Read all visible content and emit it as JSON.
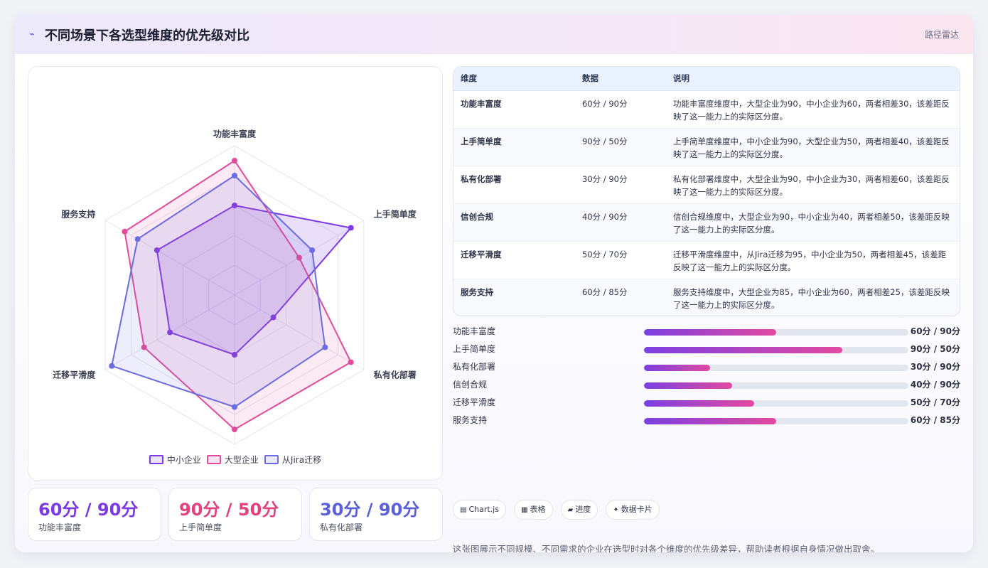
{
  "header": {
    "icon": "activity-icon",
    "title": "不同场景下各选型维度的优先级对比",
    "tag": "路径雷达"
  },
  "chart_data": {
    "type": "radar",
    "axes": [
      "功能丰富度",
      "上手简单度",
      "私有化部署",
      "信创合规",
      "迁移平滑度",
      "服务支持"
    ],
    "range": [
      0,
      100
    ],
    "grid_levels": 5,
    "grid": true,
    "legend_position": "bottom",
    "series": [
      {
        "name": "中小企业",
        "values": [
          60,
          90,
          30,
          40,
          50,
          60
        ],
        "color": "#7c3ae6"
      },
      {
        "name": "大型企业",
        "values": [
          90,
          50,
          90,
          90,
          70,
          85
        ],
        "color": "#e24a9a"
      },
      {
        "name": "从Jira迁移",
        "values": [
          80,
          60,
          70,
          75,
          95,
          75
        ],
        "color": "#6b6ce2"
      }
    ]
  },
  "stat_cards": [
    {
      "value": "60分 / 90分",
      "label": "功能丰富度",
      "color": "#7c3ae6"
    },
    {
      "value": "90分 / 50分",
      "label": "上手简单度",
      "color": "#e2437f"
    },
    {
      "value": "30分 / 90分",
      "label": "私有化部署",
      "color": "#5b5fd8"
    }
  ],
  "table": {
    "headers": [
      "维度",
      "数据",
      "说明"
    ],
    "rows": [
      {
        "name": "功能丰富度",
        "data": "60分 / 90分",
        "desc": "功能丰富度维度中，大型企业为90，中小企业为60，两者相差30，该差距反映了这一能力上的实际区分度。"
      },
      {
        "name": "上手简单度",
        "data": "90分 / 50分",
        "desc": "上手简单度维度中，中小企业为90，大型企业为50，两者相差40，该差距反映了这一能力上的实际区分度。"
      },
      {
        "name": "私有化部署",
        "data": "30分 / 90分",
        "desc": "私有化部署维度中，大型企业为90，中小企业为30，两者相差60，该差距反映了这一能力上的实际区分度。"
      },
      {
        "name": "信创合规",
        "data": "40分 / 90分",
        "desc": "信创合规维度中，大型企业为90，中小企业为40，两者相差50，该差距反映了这一能力上的实际区分度。"
      },
      {
        "name": "迁移平滑度",
        "data": "50分 / 70分",
        "desc": "迁移平滑度维度中，从Jira迁移为95，中小企业为50，两者相差45，该差距反映了这一能力上的实际区分度。"
      },
      {
        "name": "服务支持",
        "data": "60分 / 85分",
        "desc": "服务支持维度中，大型企业为85，中小企业为60，两者相差25，该差距反映了这一能力上的实际区分度。"
      }
    ]
  },
  "progress": [
    {
      "label": "功能丰富度",
      "value": "60分 / 90分",
      "fraction": 0.5
    },
    {
      "label": "上手简单度",
      "value": "90分 / 50分",
      "fraction": 0.75
    },
    {
      "label": "私有化部署",
      "value": "30分 / 90分",
      "fraction": 0.25
    },
    {
      "label": "信创合规",
      "value": "40分 / 90分",
      "fraction": 0.333
    },
    {
      "label": "迁移平滑度",
      "value": "50分 / 70分",
      "fraction": 0.417
    },
    {
      "label": "服务支持",
      "value": "60分 / 85分",
      "fraction": 0.5
    }
  ],
  "chips": [
    {
      "icon": "▤",
      "icon_name": "chart-icon",
      "label": "Chart.js"
    },
    {
      "icon": "▦",
      "icon_name": "table-icon",
      "label": "表格"
    },
    {
      "icon": "▰",
      "icon_name": "progress-icon",
      "label": "进度"
    },
    {
      "icon": "✦",
      "icon_name": "sparkle-icon",
      "label": "数据卡片"
    }
  ],
  "footnote": "这张图展示不同规模、不同需求的企业在选型时对各个维度的优先级差异，帮助读者根据自身情况做出取舍。"
}
